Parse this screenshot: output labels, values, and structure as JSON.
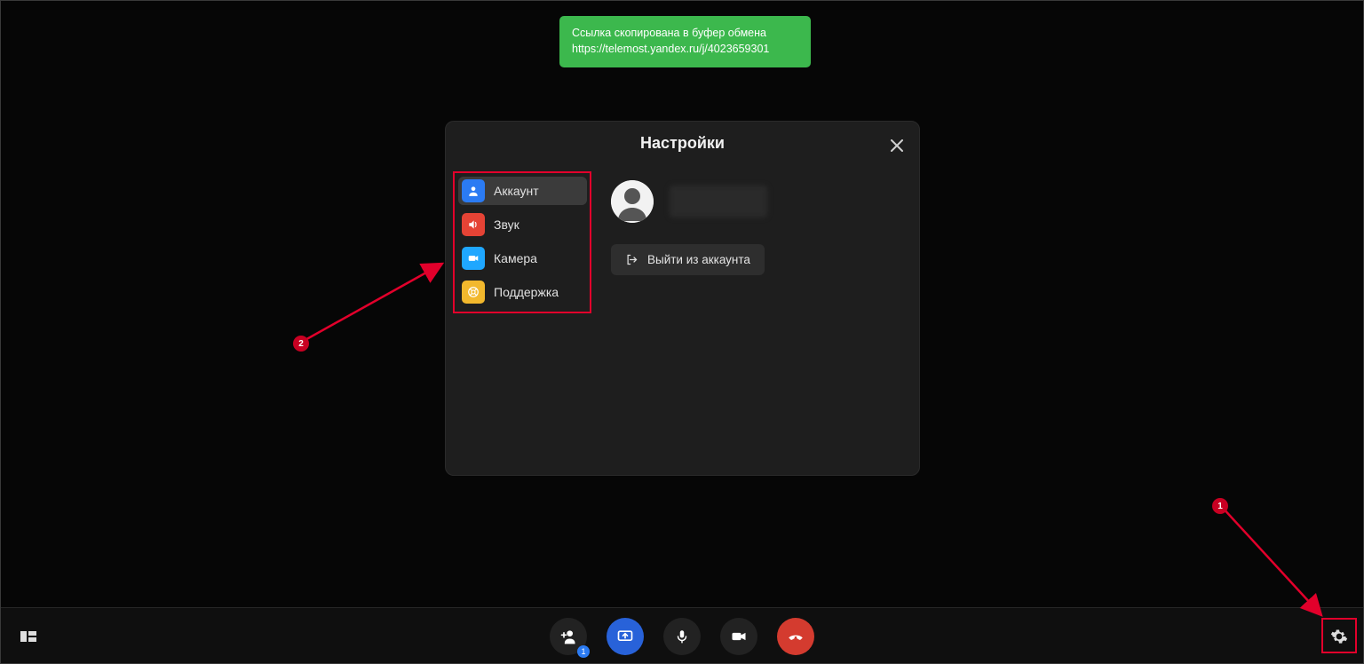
{
  "toast": {
    "line1": "Ссылка скопирована в буфер обмена",
    "line2": "https://telemost.yandex.ru/j/4023659301"
  },
  "modal": {
    "title": "Настройки",
    "close_icon_name": "close-icon",
    "nav": [
      {
        "id": "account",
        "label": "Аккаунт",
        "active": true
      },
      {
        "id": "sound",
        "label": "Звук",
        "active": false
      },
      {
        "id": "camera",
        "label": "Камера",
        "active": false
      },
      {
        "id": "support",
        "label": "Поддержка",
        "active": false
      }
    ],
    "account": {
      "logout_label": "Выйти из аккаунта"
    }
  },
  "bottombar": {
    "add_badge": "1"
  },
  "annotations": {
    "step1": "1",
    "step2": "2"
  },
  "colors": {
    "toast_bg": "#3cb84d",
    "annotation_red": "#e2002b"
  }
}
